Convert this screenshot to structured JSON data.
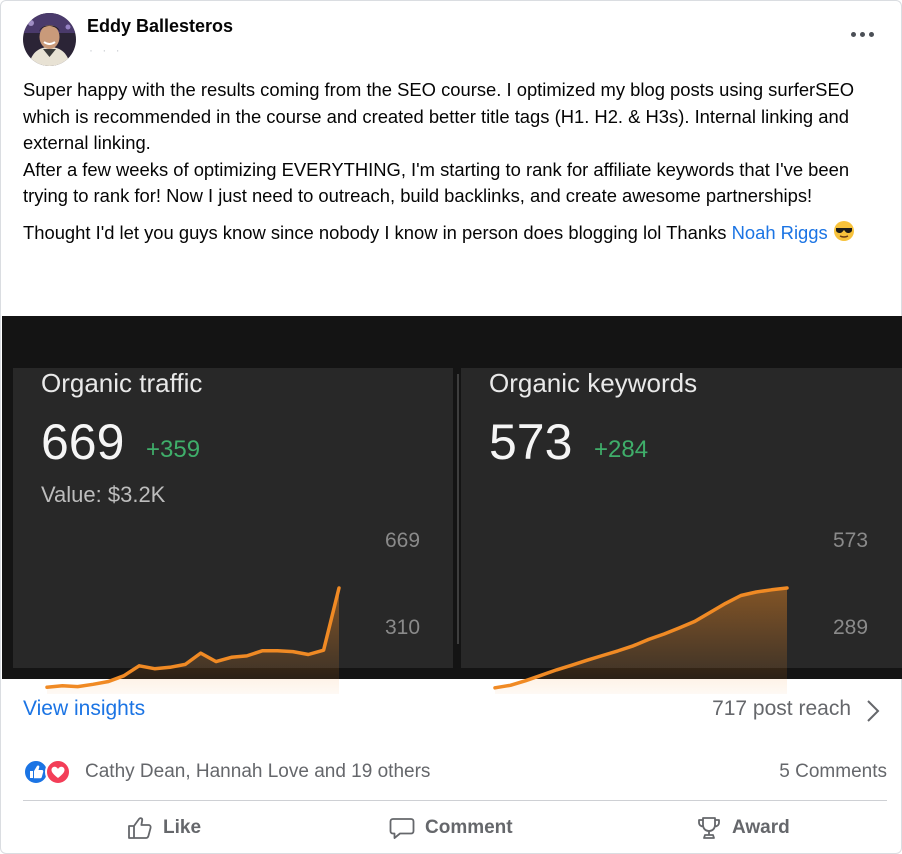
{
  "post": {
    "author": "Eddy Ballesteros",
    "meta": "· · ·",
    "paragraph1": "Super happy with the results coming from the SEO course. I optimized my blog posts using surferSEO which is recommended in the course and created better title tags (H1. H2. & H3s). Internal linking and external linking.",
    "paragraph2": "After a few weeks of optimizing EVERYTHING, I'm starting to rank for affiliate keywords that I've been trying to rank for! Now I just need to outreach, build backlinks, and create awesome partnerships!",
    "paragraph3": "Thought I'd let you guys know since nobody I know in person does blogging lol Thanks ",
    "mention": "Noah Riggs",
    "emoji": "sunglasses-emoji"
  },
  "image": {
    "traffic": {
      "title": "Organic traffic",
      "value": "669",
      "delta": "+359",
      "sub": "Value: $3.2K",
      "axis_max": "669",
      "axis_min": "310"
    },
    "keywords": {
      "title": "Organic keywords",
      "value": "573",
      "delta": "+284",
      "axis_max": "573",
      "axis_min": "289"
    }
  },
  "chart_data": [
    {
      "type": "area",
      "title": "Organic traffic",
      "ylim": [
        310,
        669
      ],
      "values": [
        320,
        325,
        322,
        330,
        340,
        360,
        395,
        385,
        390,
        400,
        440,
        410,
        425,
        430,
        448,
        448,
        445,
        435,
        450,
        669
      ],
      "color": "#f08a24"
    },
    {
      "type": "area",
      "title": "Organic keywords",
      "ylim": [
        289,
        573
      ],
      "values": [
        295,
        302,
        315,
        330,
        345,
        358,
        372,
        385,
        398,
        412,
        430,
        445,
        462,
        480,
        505,
        530,
        552,
        562,
        568,
        573
      ],
      "color": "#f08a24"
    }
  ],
  "footer": {
    "view_insights": "View insights",
    "post_reach": "717 post reach",
    "reaction_names": "Cathy Dean, Hannah Love and 19 others",
    "comments": "5 Comments"
  },
  "actions": {
    "like": "Like",
    "comment": "Comment",
    "award": "Award"
  },
  "colors": {
    "link": "#1b74e4",
    "delta_green": "#3fae6a",
    "chart_orange": "#f08a24",
    "like_blue": "#1b74e4",
    "love_red": "#f33e58"
  }
}
